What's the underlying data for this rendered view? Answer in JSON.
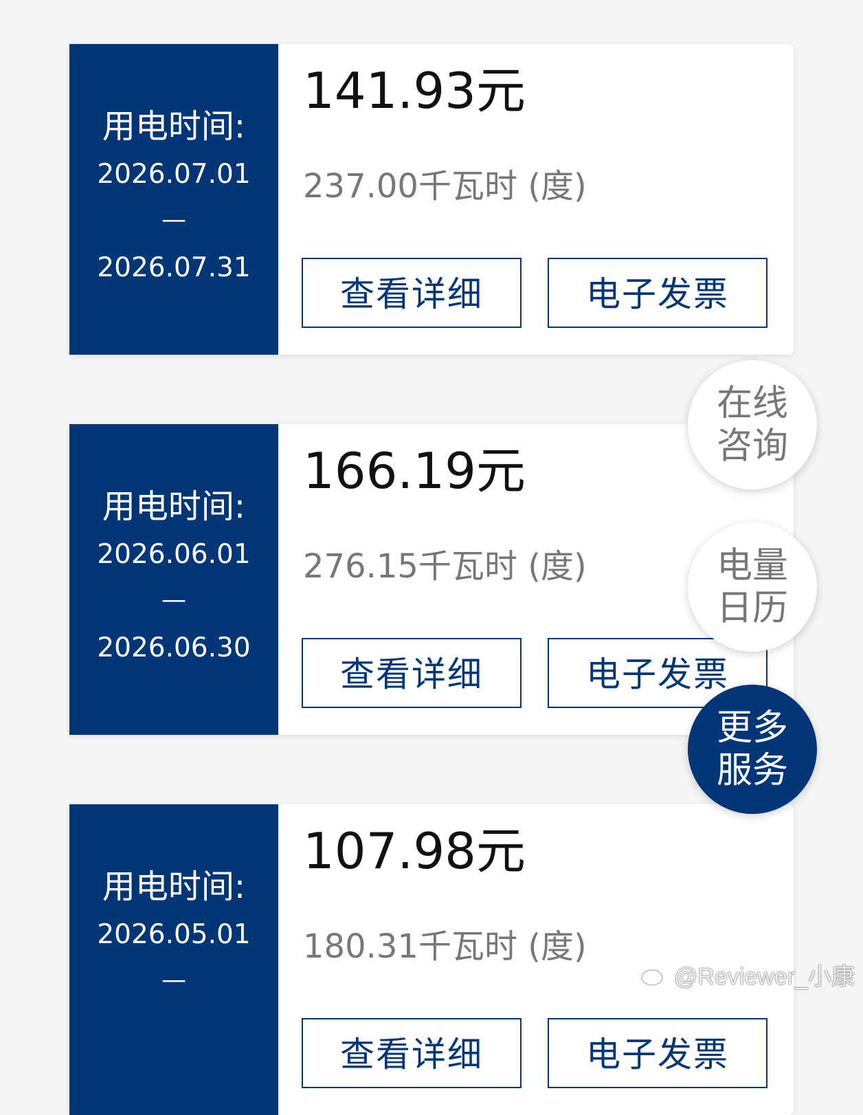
{
  "bills": [
    {
      "period_label": "用电时间:",
      "start": "2026.07.01",
      "dash": "—",
      "end": "2026.07.31",
      "amount": "141.93元",
      "usage": "237.00千瓦时 (度)",
      "detail_label": "查看详细",
      "invoice_label": "电子发票"
    },
    {
      "period_label": "用电时间:",
      "start": "2026.06.01",
      "dash": "—",
      "end": "2026.06.30",
      "amount": "166.19元",
      "usage": "276.15千瓦时 (度)",
      "detail_label": "查看详细",
      "invoice_label": "电子发票"
    },
    {
      "period_label": "用电时间:",
      "start": "2026.05.01",
      "dash": "—",
      "end": "",
      "amount": "107.98元",
      "usage": "180.31千瓦时 (度)",
      "detail_label": "查看详细",
      "invoice_label": "电子发票"
    }
  ],
  "floating": {
    "consult": {
      "line1": "在线",
      "line2": "咨询"
    },
    "calendar": {
      "line1": "电量",
      "line2": "日历"
    },
    "more": {
      "line1": "更多",
      "line2": "服务"
    }
  },
  "watermark": {
    "text": "@Reviewer_小康",
    "icon": "weibo-icon"
  },
  "colors": {
    "brand": "#033677",
    "background": "#f5f5f5",
    "muted_text": "#777777"
  }
}
